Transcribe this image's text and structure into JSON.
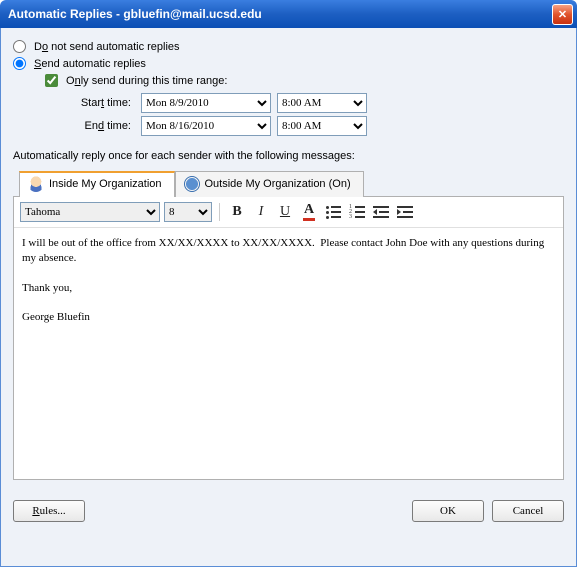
{
  "titlebar": {
    "title": "Automatic Replies - gbluefin@mail.ucsd.edu"
  },
  "options": {
    "do_not_send": "Do not send automatic replies",
    "send": "Send automatic replies",
    "only_range": "Only send during this time range:",
    "start_label": "Start time:",
    "start_date": "Mon 8/9/2010",
    "start_time": "8:00 AM",
    "end_label": "End time:",
    "end_date": "Mon 8/16/2010",
    "end_time": "8:00 AM"
  },
  "label": "Automatically reply once for each sender with the following messages:",
  "tabs": {
    "inside": "Inside My Organization",
    "outside": "Outside My Organization (On)"
  },
  "toolbar": {
    "font": "Tahoma",
    "size": "8"
  },
  "body": "I will be out of the office from XX/XX/XXXX to XX/XX/XXXX.  Please contact John Doe with any questions during my absence.\n\nThank you,\n\nGeorge Bluefin",
  "buttons": {
    "rules": "Rules...",
    "ok": "OK",
    "cancel": "Cancel"
  }
}
